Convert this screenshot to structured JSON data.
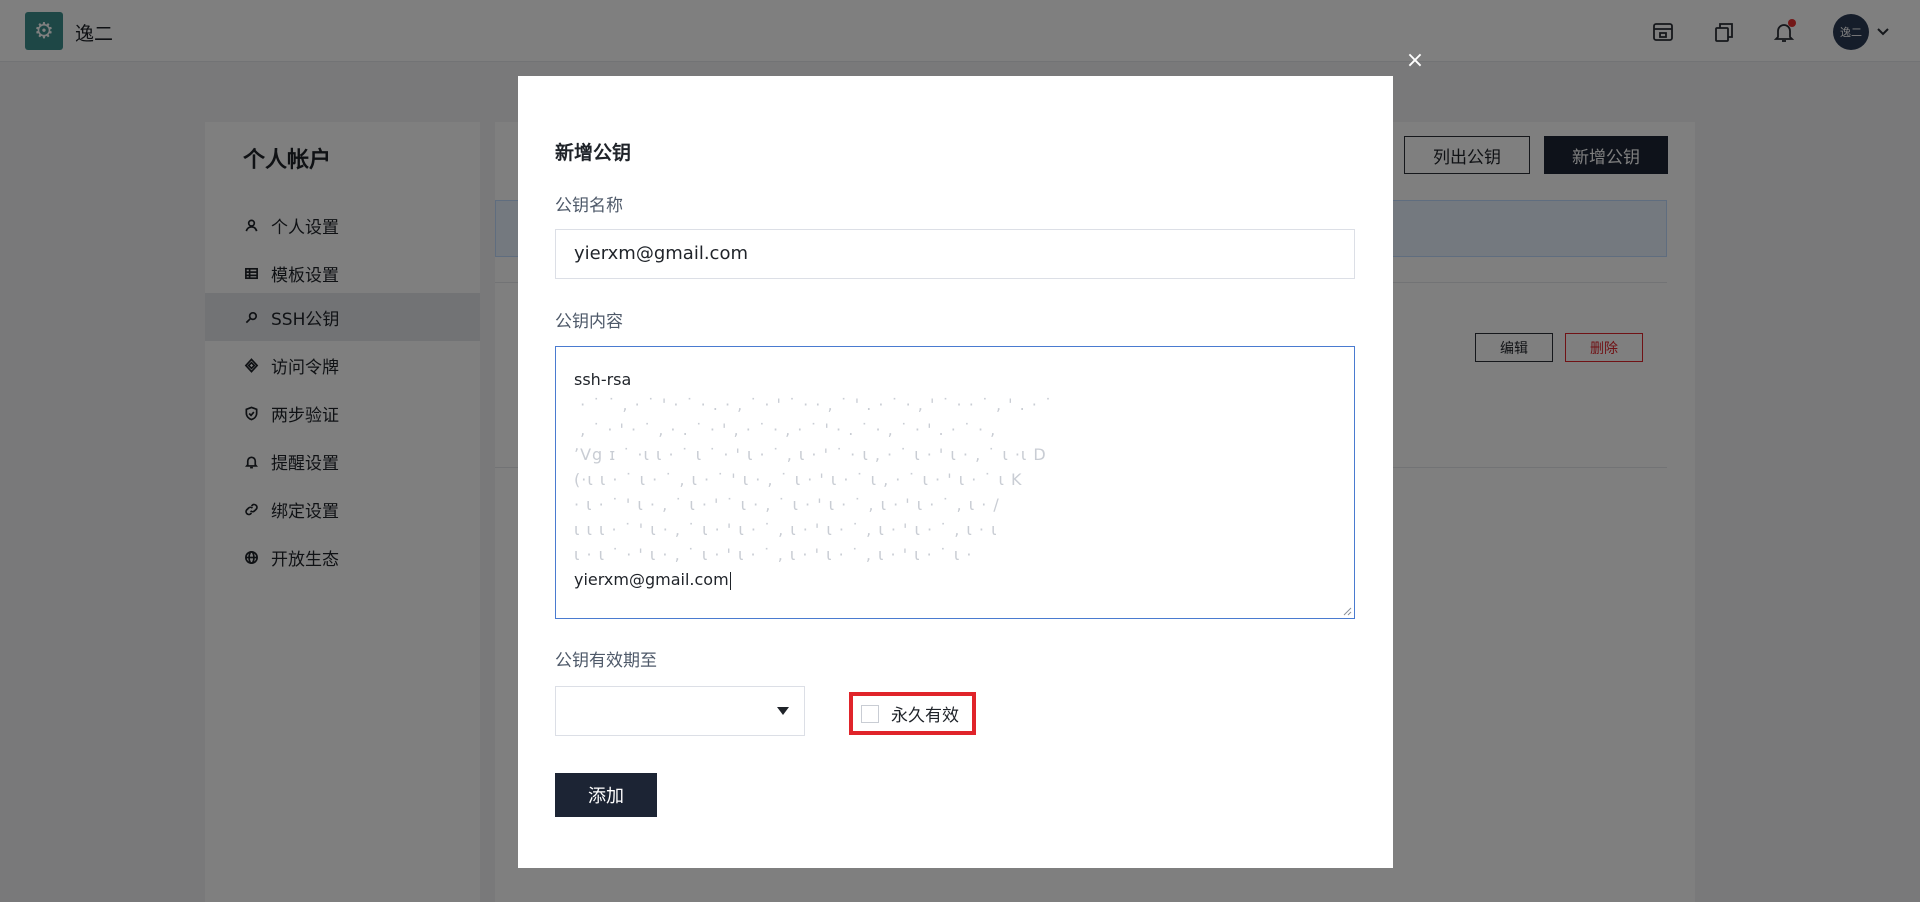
{
  "topbar": {
    "app_name": "逸二",
    "avatar_text": "逸二",
    "icons": [
      "layout-icon",
      "copy-icon",
      "bell-icon",
      "chevron-down-icon"
    ]
  },
  "sidebar": {
    "title": "个人帐户",
    "items": [
      {
        "label": "个人设置",
        "icon": "user-icon"
      },
      {
        "label": "模板设置",
        "icon": "table-icon"
      },
      {
        "label": "SSH公钥",
        "icon": "key-icon",
        "active": true
      },
      {
        "label": "访问令牌",
        "icon": "token-icon"
      },
      {
        "label": "两步验证",
        "icon": "shield-icon"
      },
      {
        "label": "提醒设置",
        "icon": "bell-icon"
      },
      {
        "label": "绑定设置",
        "icon": "link-icon"
      },
      {
        "label": "开放生态",
        "icon": "globe-icon"
      }
    ]
  },
  "content": {
    "list_button": "列出公钥",
    "new_button": "新增公钥",
    "edit_button": "编辑",
    "delete_button": "删除"
  },
  "modal": {
    "title": "新增公钥",
    "name_label": "公钥名称",
    "name_value": "yierxm@gmail.com",
    "content_label": "公钥内容",
    "content_first_line": "ssh-rsa",
    "content_last_line": "yierxm@gmail.com",
    "expiry_label": "公钥有效期至",
    "expiry_value": "",
    "permanent_label": "永久有效",
    "permanent_checked": false,
    "submit_button": "添加",
    "close_glyph": "×"
  },
  "colors": {
    "primary_dark": "#1c2434",
    "danger": "#e0242a",
    "focus_border": "#4a7bd0",
    "logo": "#3d8f8c"
  }
}
